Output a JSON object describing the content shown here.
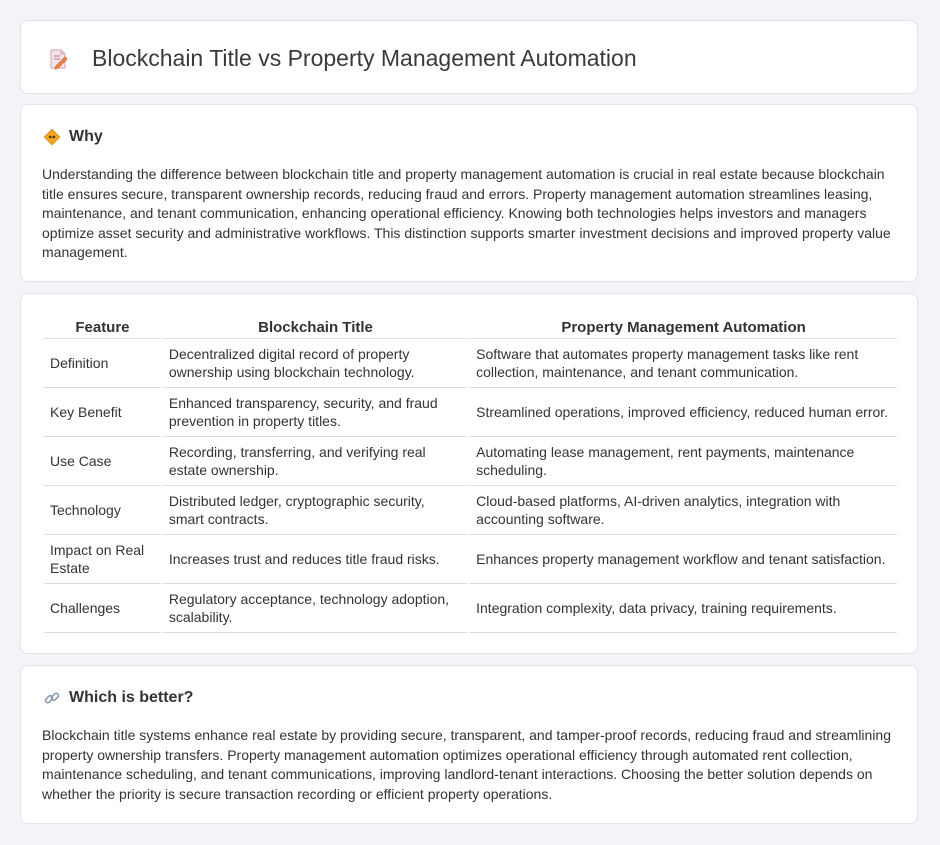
{
  "header": {
    "title": "Blockchain Title vs Property Management Automation",
    "icon": "document-pencil-icon"
  },
  "why": {
    "heading": "Why",
    "icon": "diamond-sign-icon",
    "text": "Understanding the difference between blockchain title and property management automation is crucial in real estate because blockchain title ensures secure, transparent ownership records, reducing fraud and errors. Property management automation streamlines leasing, maintenance, and tenant communication, enhancing operational efficiency. Knowing both technologies helps investors and managers optimize asset security and administrative workflows. This distinction supports smarter investment decisions and improved property value management."
  },
  "table": {
    "headers": [
      "Feature",
      "Blockchain Title",
      "Property Management Automation"
    ],
    "rows": [
      [
        "Definition",
        "Decentralized digital record of property ownership using blockchain technology.",
        "Software that automates property management tasks like rent collection, maintenance, and tenant communication."
      ],
      [
        "Key Benefit",
        "Enhanced transparency, security, and fraud prevention in property titles.",
        "Streamlined operations, improved efficiency, reduced human error."
      ],
      [
        "Use Case",
        "Recording, transferring, and verifying real estate ownership.",
        "Automating lease management, rent payments, maintenance scheduling."
      ],
      [
        "Technology",
        "Distributed ledger, cryptographic security, smart contracts.",
        "Cloud-based platforms, AI-driven analytics, integration with accounting software."
      ],
      [
        "Impact on Real Estate",
        "Increases trust and reduces title fraud risks.",
        "Enhances property management workflow and tenant satisfaction."
      ],
      [
        "Challenges",
        "Regulatory acceptance, technology adoption, scalability.",
        "Integration complexity, data privacy, training requirements."
      ]
    ]
  },
  "better": {
    "heading": "Which is better?",
    "icon": "link-icon",
    "text": "Blockchain title systems enhance real estate by providing secure, transparent, and tamper-proof records, reducing fraud and streamlining property ownership transfers. Property management automation optimizes operational efficiency through automated rent collection, maintenance scheduling, and tenant communications, improving landlord-tenant interactions. Choosing the better solution depends on whether the priority is secure transaction recording or efficient property operations."
  },
  "colors": {
    "background": "#f3f4f8",
    "card": "#ffffff",
    "accent_orange": "#f5a623",
    "icon_pink": "#e57373"
  }
}
